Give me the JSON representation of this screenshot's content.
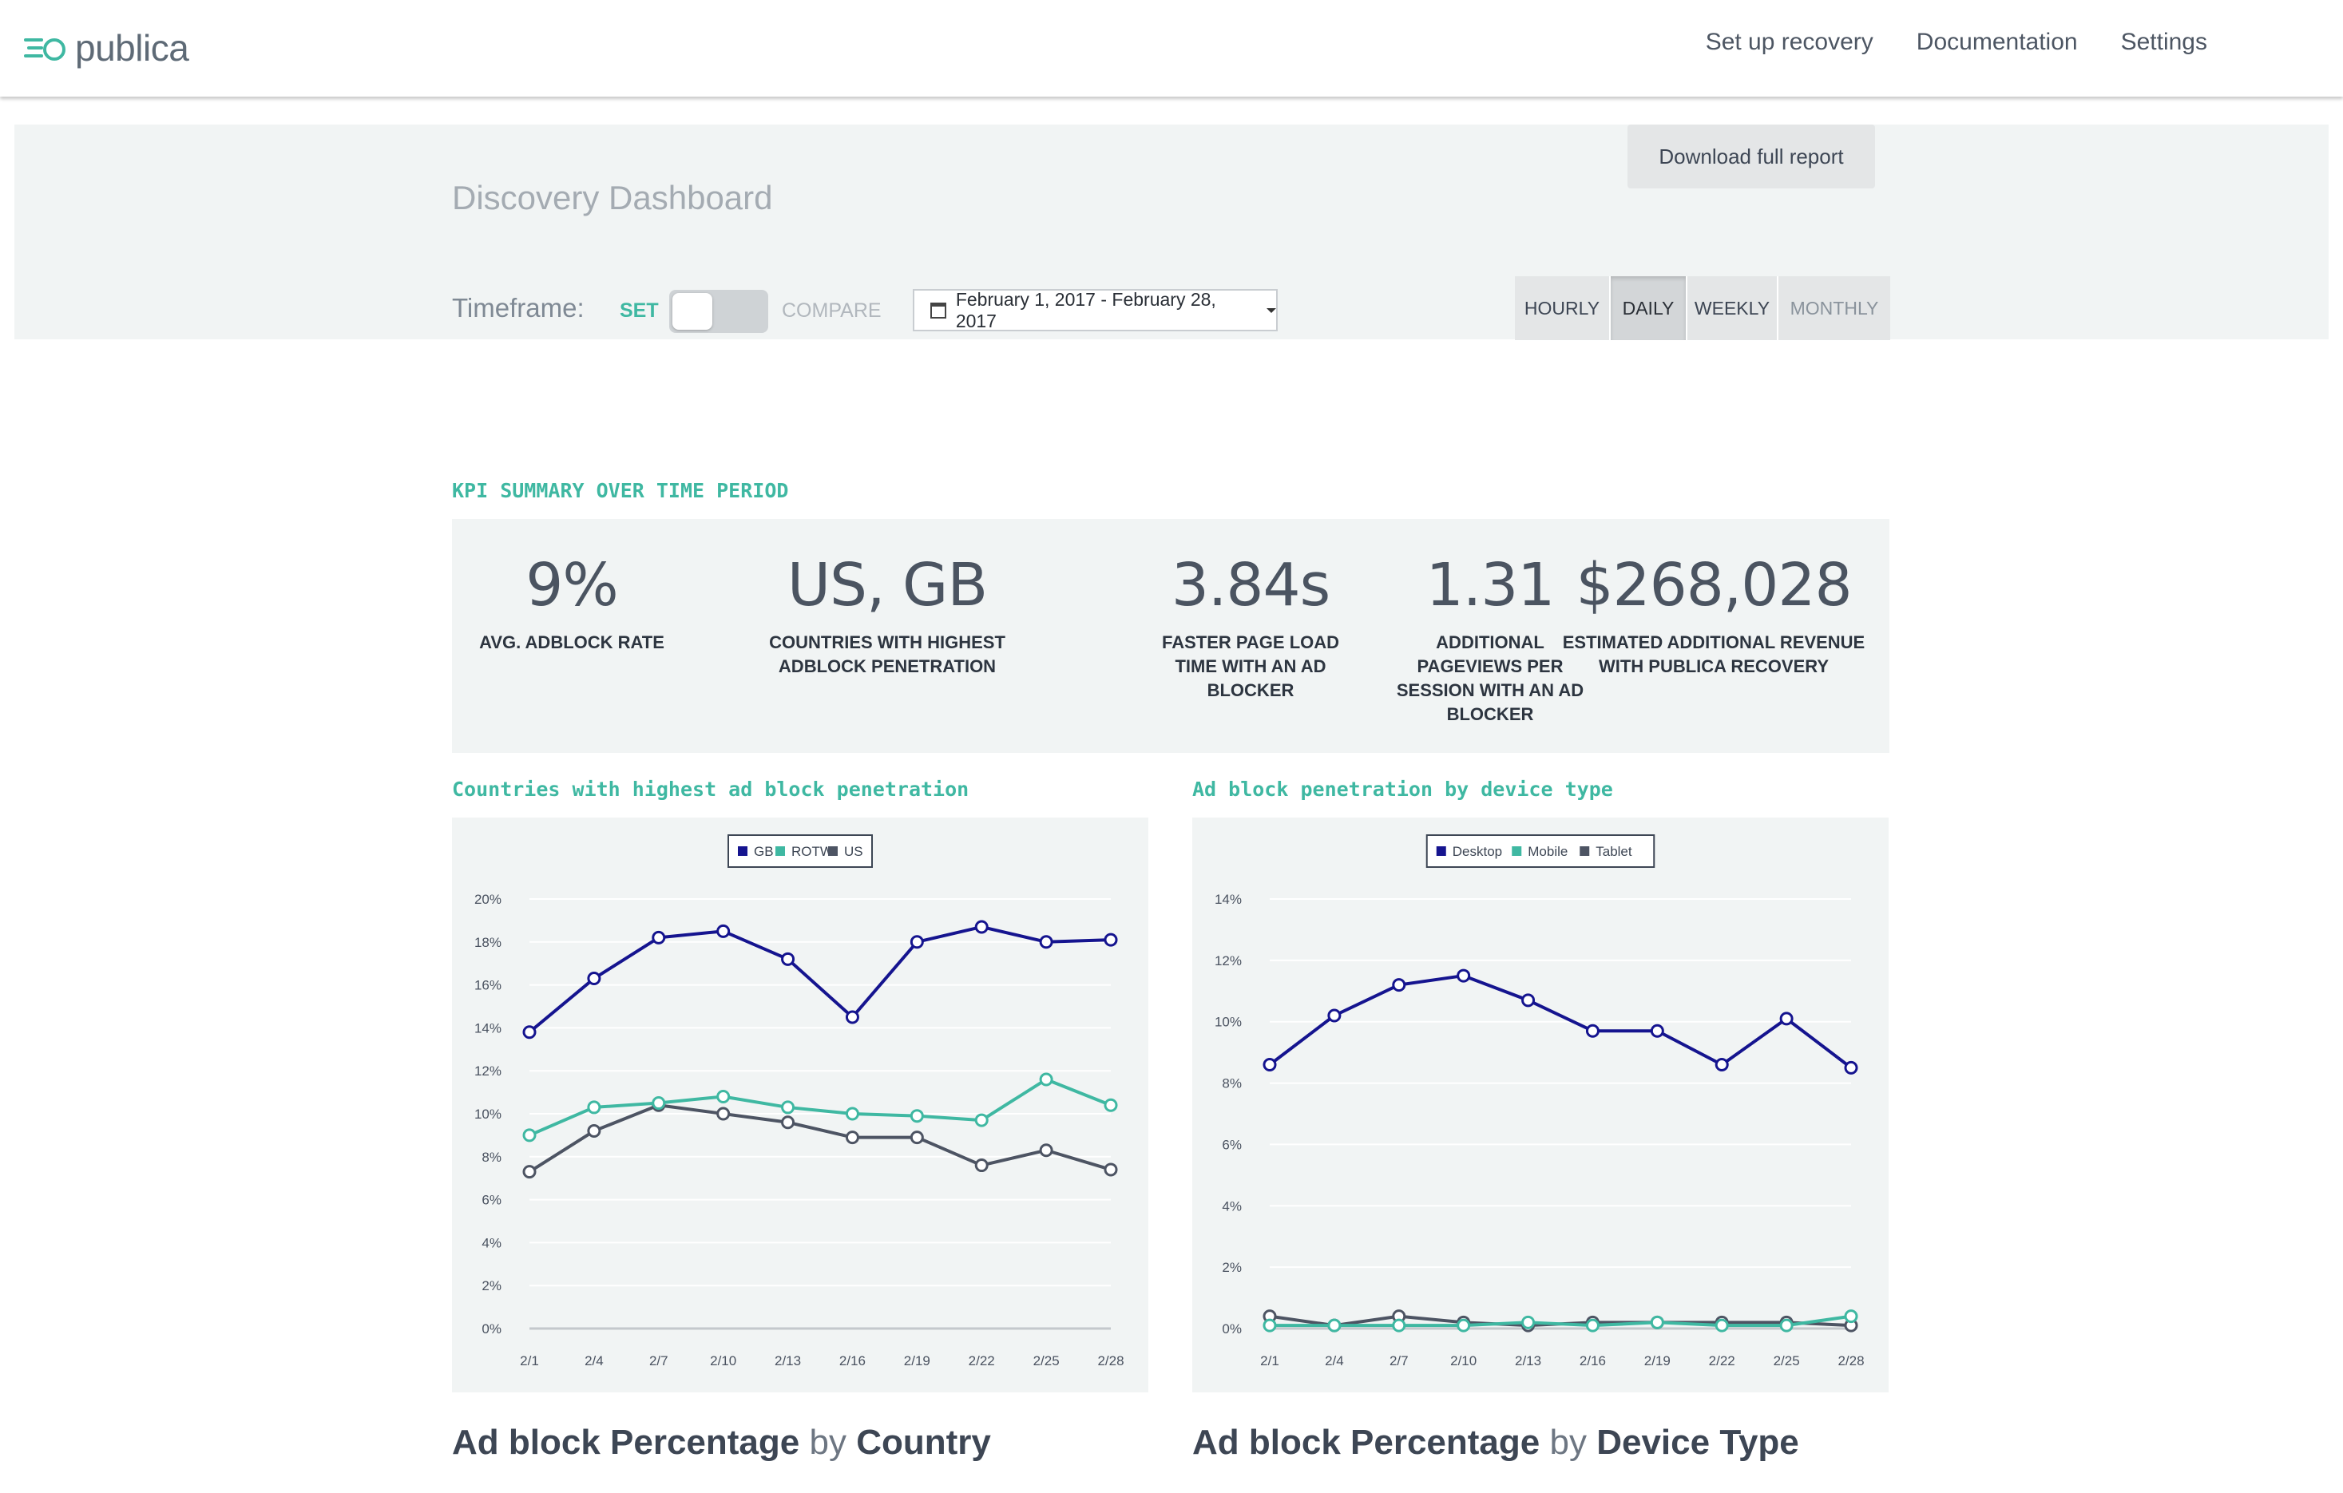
{
  "brand": {
    "name": "publica",
    "accent": "#3fb8a2"
  },
  "nav": {
    "items": [
      "Set up recovery",
      "Documentation",
      "Settings"
    ]
  },
  "page": {
    "title": "Discovery Dashboard",
    "download_label": "Download full report"
  },
  "timeframe": {
    "label": "Timeframe:",
    "set_label": "SET",
    "compare_label": "COMPARE",
    "date_range": "February 1, 2017 - February 28, 2017",
    "granularity": [
      {
        "label": "HOURLY",
        "state": "normal"
      },
      {
        "label": "DAILY",
        "state": "active"
      },
      {
        "label": "WEEKLY",
        "state": "normal"
      },
      {
        "label": "MONTHLY",
        "state": "muted"
      }
    ]
  },
  "kpi": {
    "heading": "KPI SUMMARY OVER TIME PERIOD",
    "items": [
      {
        "value": "9%",
        "label_lines": [
          "AVG. ADBLOCK RATE"
        ]
      },
      {
        "value": "US, GB",
        "label_lines": [
          "COUNTRIES WITH HIGHEST",
          "ADBLOCK PENETRATION"
        ]
      },
      {
        "value": "3.84s",
        "label_lines": [
          "FASTER PAGE LOAD",
          "TIME WITH AN AD",
          "BLOCKER"
        ]
      },
      {
        "value": "1.31",
        "label_lines": [
          "ADDITIONAL",
          "PAGEVIEWS PER",
          "SESSION WITH AN AD",
          "BLOCKER"
        ]
      },
      {
        "value": "$268,028",
        "label_lines": [
          "ESTIMATED ADDITIONAL REVENUE",
          "WITH PUBLICA RECOVERY"
        ]
      }
    ]
  },
  "charts": {
    "left_heading": "Countries with highest ad block penetration",
    "right_heading": "Ad block penetration by device type",
    "left_title": {
      "bold1": "Ad block Percentage",
      "light": "by",
      "bold2": "Country"
    },
    "right_title": {
      "bold1": "Ad block Percentage",
      "light": "by",
      "bold2": "Device Type"
    }
  },
  "chart_data": [
    {
      "type": "line",
      "x": [
        "2/1",
        "2/4",
        "2/7",
        "2/10",
        "2/13",
        "2/16",
        "2/19",
        "2/22",
        "2/25",
        "2/28"
      ],
      "yticks": [
        "0%",
        "2%",
        "4%",
        "6%",
        "8%",
        "10%",
        "12%",
        "14%",
        "16%",
        "18%",
        "20%"
      ],
      "ylim": [
        0,
        20
      ],
      "legend_position": "top-center",
      "grid": true,
      "series": [
        {
          "name": "GB",
          "color": "#15148f",
          "values": [
            13.8,
            16.3,
            18.2,
            18.5,
            17.2,
            14.5,
            18.0,
            18.7,
            18.0,
            18.1
          ]
        },
        {
          "name": "ROTW",
          "color": "#3fb8a2",
          "values": [
            9.0,
            10.3,
            10.5,
            10.8,
            10.3,
            10.0,
            9.9,
            9.7,
            11.6,
            10.4
          ]
        },
        {
          "name": "US",
          "color": "#4d5463",
          "values": [
            7.3,
            9.2,
            10.4,
            10.0,
            9.6,
            8.9,
            8.9,
            7.6,
            8.3,
            7.4
          ]
        }
      ]
    },
    {
      "type": "line",
      "x": [
        "2/1",
        "2/4",
        "2/7",
        "2/10",
        "2/13",
        "2/16",
        "2/19",
        "2/22",
        "2/25",
        "2/28"
      ],
      "yticks": [
        "0%",
        "2%",
        "4%",
        "6%",
        "8%",
        "10%",
        "12%",
        "14%"
      ],
      "ylim": [
        0,
        14
      ],
      "legend_position": "top-center",
      "grid": true,
      "series": [
        {
          "name": "Desktop",
          "color": "#15148f",
          "values": [
            8.6,
            10.2,
            11.2,
            11.5,
            10.7,
            9.7,
            9.7,
            8.6,
            10.1,
            8.5
          ]
        },
        {
          "name": "Mobile",
          "color": "#3fb8a2",
          "values": [
            0.1,
            0.1,
            0.1,
            0.1,
            0.2,
            0.1,
            0.2,
            0.1,
            0.1,
            0.4
          ]
        },
        {
          "name": "Tablet",
          "color": "#4d5463",
          "values": [
            0.4,
            0.1,
            0.4,
            0.2,
            0.1,
            0.2,
            0.2,
            0.2,
            0.2,
            0.1
          ]
        }
      ]
    }
  ]
}
